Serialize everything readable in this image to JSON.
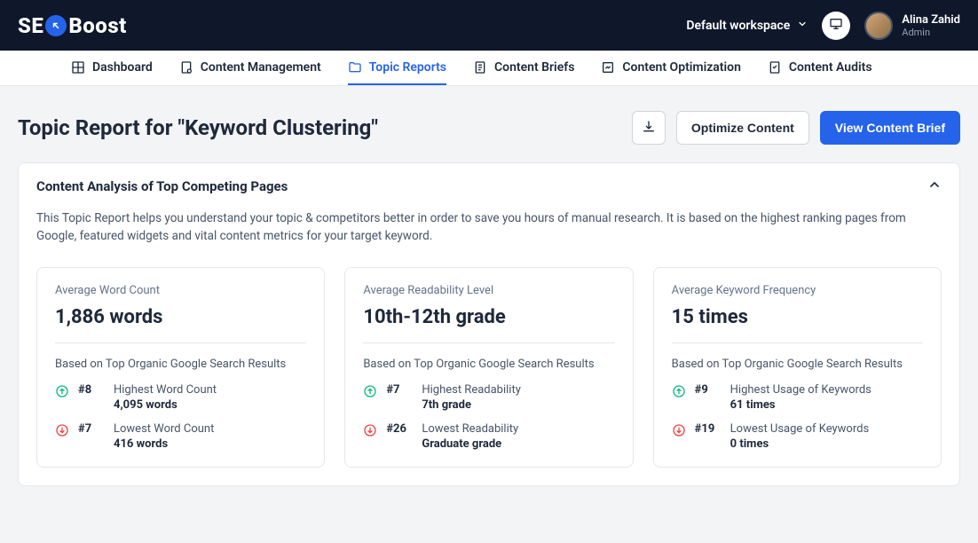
{
  "header": {
    "logo_pre": "SE",
    "logo_post": "Boost",
    "workspace_label": "Default workspace",
    "user_name": "Alina Zahid",
    "user_role": "Admin"
  },
  "nav": {
    "items": [
      {
        "label": "Dashboard"
      },
      {
        "label": "Content Management"
      },
      {
        "label": "Topic Reports"
      },
      {
        "label": "Content Briefs"
      },
      {
        "label": "Content Optimization"
      },
      {
        "label": "Content Audits"
      }
    ]
  },
  "page": {
    "title": "Topic Report for \"Keyword Clustering\"",
    "optimize_btn": "Optimize Content",
    "brief_btn": "View Content Brief"
  },
  "analysis": {
    "title": "Content Analysis of Top Competing Pages",
    "description": "This Topic Report helps you understand your topic & competitors better in order to save you hours of manual research. It is based on the highest ranking pages from Google, featured widgets and vital content metrics for your target keyword.",
    "based_on": "Based on Top Organic Google Search Results",
    "stats": [
      {
        "label": "Average Word Count",
        "value": "1,886 words",
        "high_rank": "#8",
        "high_label": "Highest Word Count",
        "high_val": "4,095 words",
        "low_rank": "#7",
        "low_label": "Lowest Word Count",
        "low_val": "416 words"
      },
      {
        "label": "Average Readability Level",
        "value": "10th-12th grade",
        "high_rank": "#7",
        "high_label": "Highest Readability",
        "high_val": "7th grade",
        "low_rank": "#26",
        "low_label": "Lowest Readability",
        "low_val": "Graduate grade"
      },
      {
        "label": "Average Keyword Frequency",
        "value": "15 times",
        "high_rank": "#9",
        "high_label": "Highest Usage of Keywords",
        "high_val": "61 times",
        "low_rank": "#19",
        "low_label": "Lowest Usage of Keywords",
        "low_val": "0 times"
      }
    ]
  }
}
